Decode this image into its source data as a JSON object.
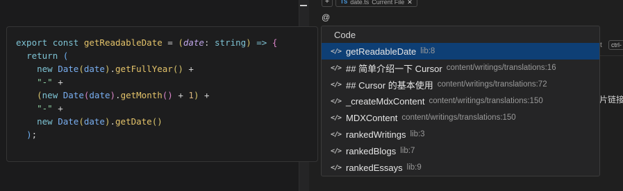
{
  "top_bar": {
    "plus": "+",
    "file_chip": {
      "icon": "ts-file-icon",
      "icon_text": "TS",
      "filename": "date.ts",
      "tag": "Current File",
      "close": "✕"
    }
  },
  "composer": {
    "at_text": "@"
  },
  "peek": {
    "t": "t",
    "kbd": "ctrl-",
    "zh": "片链接"
  },
  "code": {
    "lines": [
      [
        [
          "kw",
          "export"
        ],
        [
          "op",
          " "
        ],
        [
          "kw",
          "const"
        ],
        [
          "op",
          " "
        ],
        [
          "fn",
          "getReadableDate"
        ],
        [
          "op",
          " = "
        ],
        [
          "br1",
          "("
        ],
        [
          "par",
          "date"
        ],
        [
          "op",
          ": "
        ],
        [
          "kw",
          "string"
        ],
        [
          "br1",
          ")"
        ],
        [
          "op",
          " "
        ],
        [
          "arrow",
          "=>"
        ],
        [
          "op",
          " "
        ],
        [
          "br2",
          "{"
        ]
      ],
      [
        [
          "op",
          "  "
        ],
        [
          "kw",
          "return"
        ],
        [
          "op",
          " "
        ],
        [
          "br3",
          "("
        ]
      ],
      [
        [
          "op",
          "    "
        ],
        [
          "kw",
          "new"
        ],
        [
          "op",
          " "
        ],
        [
          "id",
          "Date"
        ],
        [
          "br1",
          "("
        ],
        [
          "id",
          "date"
        ],
        [
          "br1",
          ")"
        ],
        [
          "op",
          "."
        ],
        [
          "fn",
          "getFullYear"
        ],
        [
          "br1",
          "()"
        ],
        [
          "op",
          " +"
        ]
      ],
      [
        [
          "op",
          "    "
        ],
        [
          "str",
          "\"-\""
        ],
        [
          "op",
          " +"
        ]
      ],
      [
        [
          "op",
          "    "
        ],
        [
          "br1",
          "("
        ],
        [
          "kw",
          "new"
        ],
        [
          "op",
          " "
        ],
        [
          "id",
          "Date"
        ],
        [
          "br2",
          "("
        ],
        [
          "id",
          "date"
        ],
        [
          "br2",
          ")"
        ],
        [
          "op",
          "."
        ],
        [
          "fn",
          "getMonth"
        ],
        [
          "br2",
          "()"
        ],
        [
          "op",
          " + "
        ],
        [
          "num",
          "1"
        ],
        [
          "br1",
          ")"
        ],
        [
          "op",
          " +"
        ]
      ],
      [
        [
          "op",
          "    "
        ],
        [
          "str",
          "\"-\""
        ],
        [
          "op",
          " +"
        ]
      ],
      [
        [
          "op",
          "    "
        ],
        [
          "kw",
          "new"
        ],
        [
          "op",
          " "
        ],
        [
          "id",
          "Date"
        ],
        [
          "br1",
          "("
        ],
        [
          "id",
          "date"
        ],
        [
          "br1",
          ")"
        ],
        [
          "op",
          "."
        ],
        [
          "fn",
          "getDate"
        ],
        [
          "br1",
          "()"
        ]
      ],
      [
        [
          "op",
          "  "
        ],
        [
          "br3",
          ")"
        ],
        [
          "op",
          ";"
        ]
      ]
    ]
  },
  "dropdown": {
    "header": "Code",
    "items": [
      {
        "label": "getReadableDate",
        "path": "lib:8",
        "selected": true
      },
      {
        "label": "## 简单介绍一下 Cursor",
        "path": "content/writings/translations:16",
        "selected": false
      },
      {
        "label": "## Cursor 的基本使用",
        "path": "content/writings/translations:72",
        "selected": false
      },
      {
        "label": "_createMdxContent",
        "path": "content/writings/translations:150",
        "selected": false
      },
      {
        "label": "MDXContent",
        "path": "content/writings/translations:150",
        "selected": false
      },
      {
        "label": "rankedWritings",
        "path": "lib:3",
        "selected": false
      },
      {
        "label": "rankedBlogs",
        "path": "lib:7",
        "selected": false
      },
      {
        "label": "rankedEssays",
        "path": "lib:9",
        "selected": false
      }
    ],
    "item_icon": "code-symbol-icon",
    "item_icon_text": "</>"
  },
  "colors": {
    "selected_bg": "#0e3f75",
    "panel_bg": "#252526",
    "editor_bg": "#1b1b1c"
  }
}
